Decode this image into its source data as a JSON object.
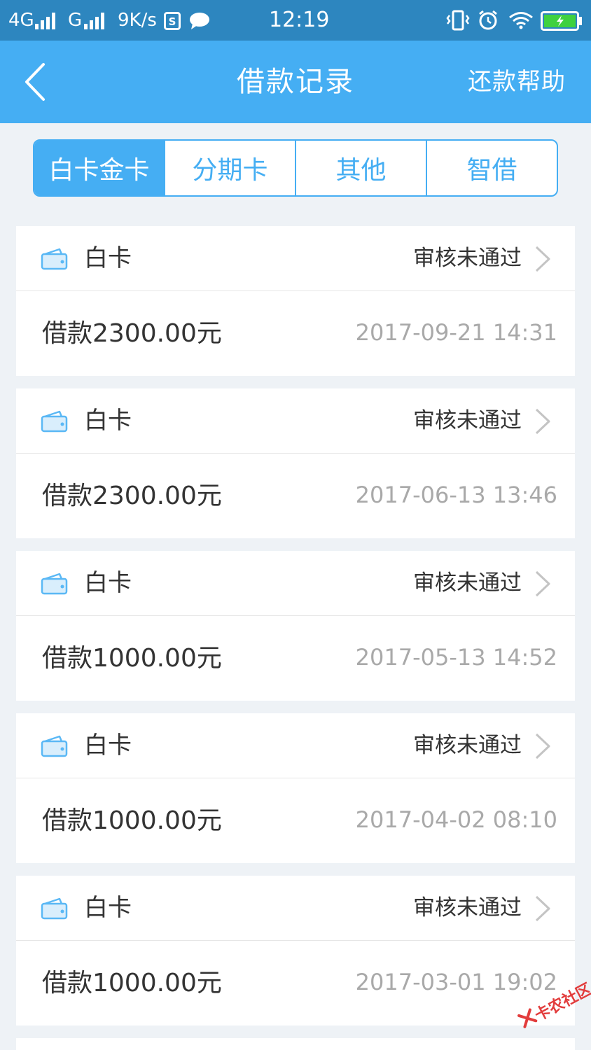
{
  "status_bar": {
    "network": "4G",
    "network2": "G",
    "speed": "9K/s",
    "time": "12:19",
    "icons": [
      "signal-icon",
      "signal-icon",
      "sim-s-icon",
      "chat-bubble-icon",
      "vibrate-icon",
      "alarm-icon",
      "wifi-icon",
      "battery-charging-icon"
    ]
  },
  "nav": {
    "back_icon": "chevron-left-icon",
    "title": "借款记录",
    "right_action": "还款帮助"
  },
  "tabs": [
    {
      "label": "白卡金卡",
      "active": true
    },
    {
      "label": "分期卡",
      "active": false
    },
    {
      "label": "其他",
      "active": false
    },
    {
      "label": "智借",
      "active": false
    }
  ],
  "records": [
    {
      "card": "白卡",
      "status": "审核未通过",
      "amount": "借款2300.00元",
      "datetime": "2017-09-21 14:31"
    },
    {
      "card": "白卡",
      "status": "审核未通过",
      "amount": "借款2300.00元",
      "datetime": "2017-06-13 13:46"
    },
    {
      "card": "白卡",
      "status": "审核未通过",
      "amount": "借款1000.00元",
      "datetime": "2017-05-13 14:52"
    },
    {
      "card": "白卡",
      "status": "审核未通过",
      "amount": "借款1000.00元",
      "datetime": "2017-04-02 08:10"
    },
    {
      "card": "白卡",
      "status": "审核未通过",
      "amount": "借款1000.00元",
      "datetime": "2017-03-01 19:02"
    }
  ],
  "watermark": "卡农社区",
  "colors": {
    "status_bar": "#2d86bf",
    "primary": "#45aef3",
    "background": "#eef2f6",
    "text": "#333333",
    "muted": "#a9a9a9"
  }
}
